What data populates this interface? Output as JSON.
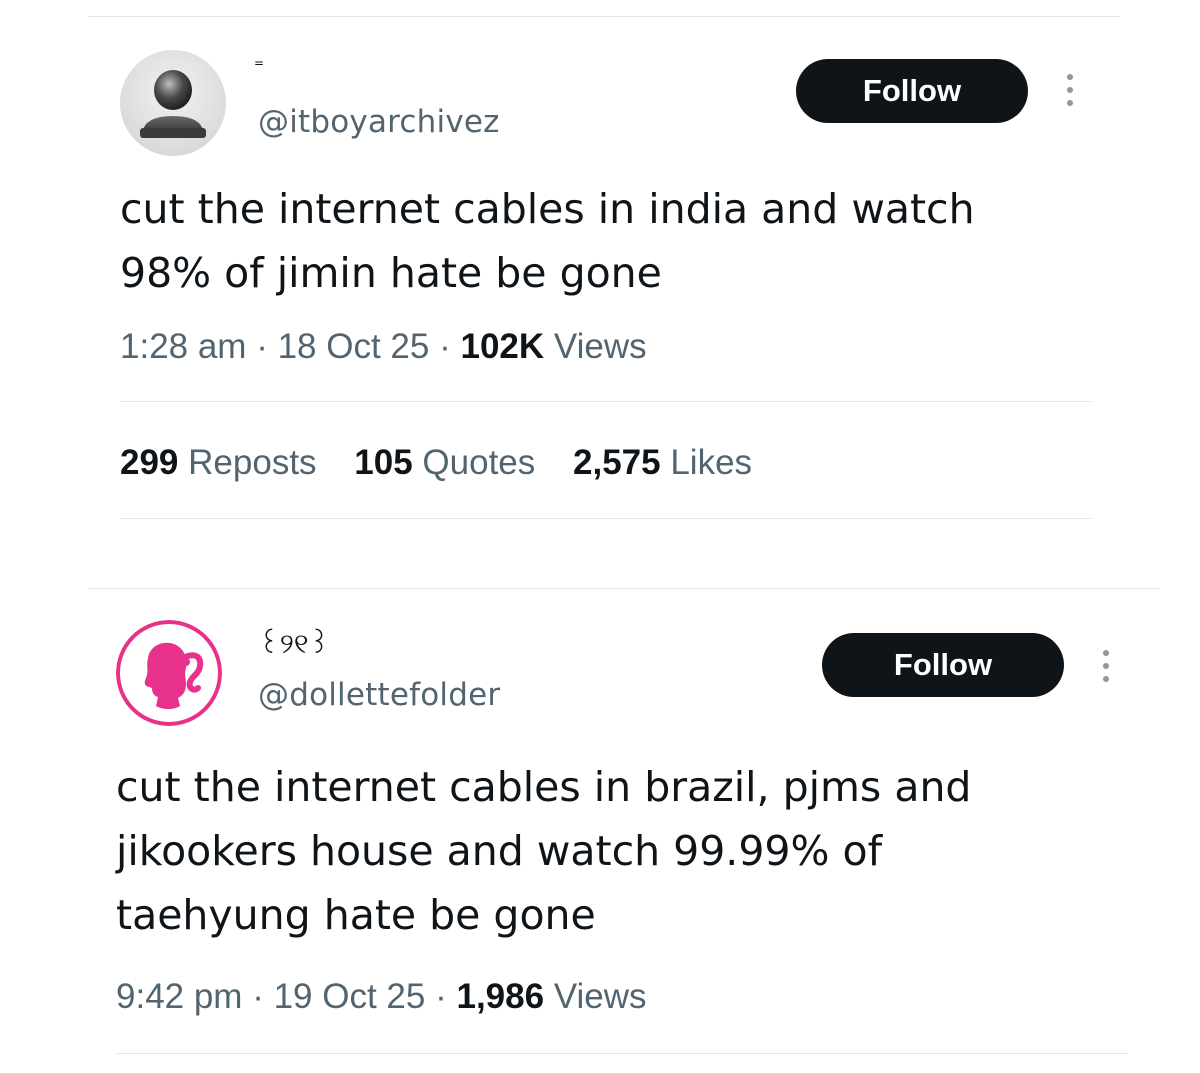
{
  "tweets": [
    {
      "display_name": "=",
      "handle": "@itboyarchivez",
      "follow_label": "Follow",
      "avatar_icon": "default-person-avatar",
      "lines": [
        "cut the internet cables in india and watch",
        "98% of jimin hate be gone"
      ],
      "time": "1:28 am",
      "sep": "·",
      "date": "18 Oct 25",
      "views_count": "102K",
      "views_label": "Views",
      "stats": [
        {
          "count": "299",
          "label": "Reposts"
        },
        {
          "count": "105",
          "label": "Quotes"
        },
        {
          "count": "2,575",
          "label": "Likes"
        }
      ]
    },
    {
      "display_name": "꒰୨୧꒱",
      "handle": "@dollettefolder",
      "follow_label": "Follow",
      "avatar_icon": "barbie-silhouette-logo",
      "lines": [
        "cut the internet cables in brazil, pjms and",
        "jikookers house and watch 99.99% of",
        "taehyung hate be gone"
      ],
      "time": "9:42 pm",
      "sep": "·",
      "date": "19 Oct 25",
      "views_count": "1,986",
      "views_label": "Views"
    }
  ],
  "colors": {
    "text": "#0f1419",
    "secondary": "#536471",
    "button": "#0f1419",
    "divider": "#e3e5e8",
    "barbie_pink": "#e8318a"
  }
}
